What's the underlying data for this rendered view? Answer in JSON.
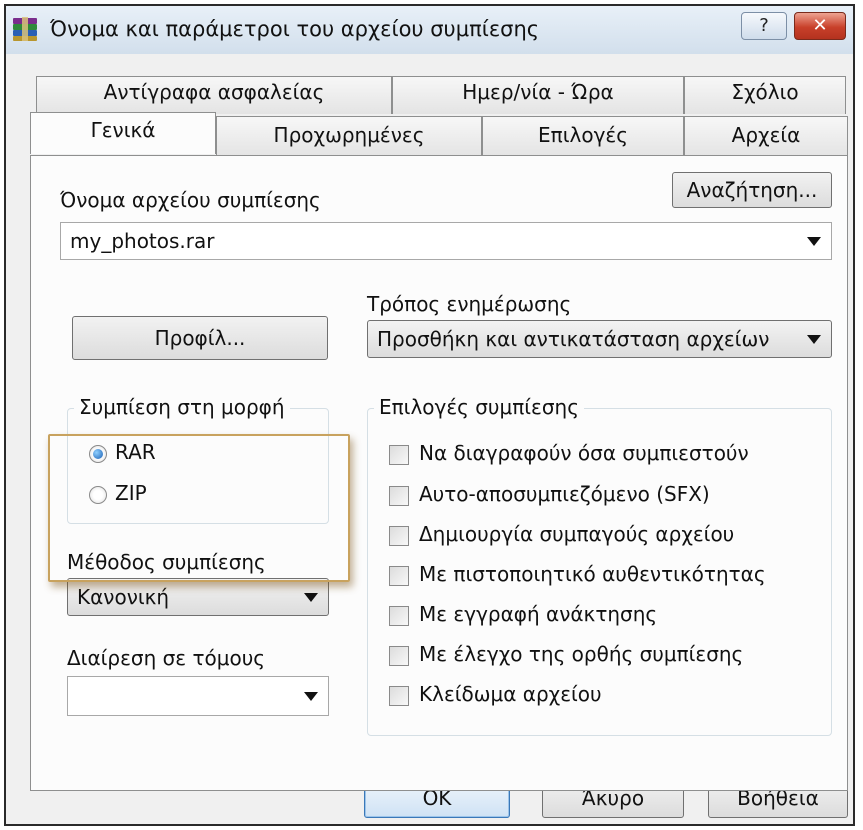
{
  "window": {
    "title": "Όνομα και παράμετροι του αρχείου συμπίεσης",
    "help_label": "?",
    "close_label": "✕",
    "icon": "winrar-books-icon"
  },
  "tabs": {
    "back_row": [
      "Αντίγραφα ασφαλείας",
      "Ημερ/νία - Ώρα",
      "Σχόλιο"
    ],
    "front_row": [
      "Γενικά",
      "Προχωρημένες",
      "Επιλογές",
      "Αρχεία"
    ],
    "active": "Γενικά"
  },
  "general": {
    "archive_name_label": "Όνομα αρχείου συμπίεσης",
    "browse_label": "Αναζήτηση...",
    "archive_name_value": "my_photos.rar",
    "update_mode_label": "Τρόπος ενημέρωσης",
    "update_mode_value": "Προσθήκη και αντικατάσταση αρχείων",
    "profiles_label": "Προφίλ...",
    "format_group": {
      "legend": "Συμπίεση στη μορφή",
      "options": [
        "RAR",
        "ZIP"
      ],
      "selected": "RAR"
    },
    "method_label": "Μέθοδος συμπίεσης",
    "method_value": "Κανονική",
    "volumes_label": "Διαίρεση σε τόμους",
    "volumes_value": "",
    "options_group": {
      "legend": "Επιλογές συμπίεσης",
      "items": [
        {
          "label": "Να διαγραφούν όσα συμπιεστούν",
          "checked": false
        },
        {
          "label": "Αυτο-αποσυμπιεζόμενο (SFX)",
          "checked": false
        },
        {
          "label": "Δημιουργία συμπαγούς αρχείου",
          "checked": false
        },
        {
          "label": "Με πιστοποιητικό αυθεντικότητας",
          "checked": false
        },
        {
          "label": "Με εγγραφή ανάκτησης",
          "checked": false
        },
        {
          "label": "Με έλεγχο της ορθής συμπίεσης",
          "checked": false
        },
        {
          "label": "Κλείδωμα αρχείου",
          "checked": false
        }
      ]
    }
  },
  "buttons": {
    "ok": "OK",
    "cancel": "Άκυρο",
    "help": "Βοήθεια"
  },
  "colors": {
    "highlight_border": "#c8a25e",
    "radio_fill": "#1a5fb4",
    "close_red": "#c8402a"
  }
}
